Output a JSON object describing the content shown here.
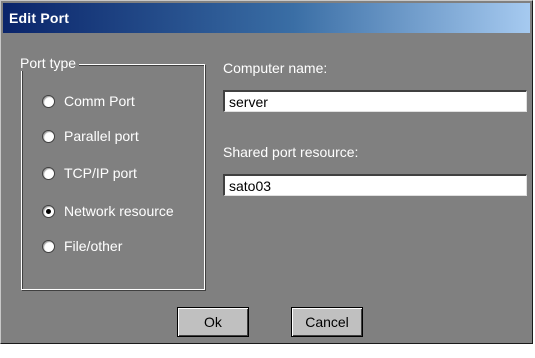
{
  "window": {
    "title": "Edit Port"
  },
  "port_type": {
    "legend": "Port type",
    "options": [
      {
        "label": "Comm Port",
        "checked": false
      },
      {
        "label": "Parallel port",
        "checked": false
      },
      {
        "label": "TCP/IP port",
        "checked": false
      },
      {
        "label": "Network resource",
        "checked": true
      },
      {
        "label": "File/other",
        "checked": false
      }
    ]
  },
  "computer_name": {
    "label": "Computer name:",
    "value": "server"
  },
  "shared_port": {
    "label": "Shared port resource:",
    "value": "sato03"
  },
  "buttons": {
    "ok": "Ok",
    "cancel": "Cancel"
  }
}
